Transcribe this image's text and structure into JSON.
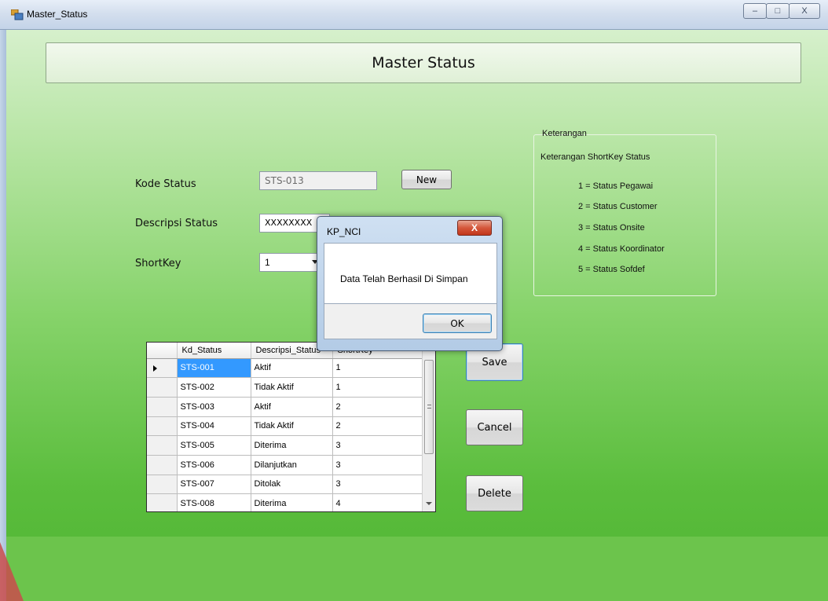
{
  "window": {
    "title": "Master_Status",
    "buttons": {
      "minimize": "–",
      "maximize": "□",
      "close": "X"
    }
  },
  "header": {
    "title": "Master Status"
  },
  "form": {
    "kode_label": "Kode Status",
    "kode_value": "STS-013",
    "new_label": "New",
    "descripsi_label": "Descripsi Status",
    "descripsi_value": "XXXXXXXX",
    "shortkey_label": "ShortKey",
    "shortkey_value": "1"
  },
  "keterangan": {
    "title": "Keterangan",
    "subtitle": "Keterangan ShortKey Status",
    "items": [
      "1 = Status Pegawai",
      "2 = Status Customer",
      "3 = Status Onsite",
      "4 = Status Koordinator",
      "5 = Status Sofdef"
    ]
  },
  "grid": {
    "columns": [
      "Kd_Status",
      "Descripsi_Status",
      "ShortKey"
    ],
    "rows": [
      [
        "STS-001",
        "Aktif",
        "1"
      ],
      [
        "STS-002",
        "Tidak Aktif",
        "1"
      ],
      [
        "STS-003",
        "Aktif",
        "2"
      ],
      [
        "STS-004",
        "Tidak Aktif",
        "2"
      ],
      [
        "STS-005",
        "Diterima",
        "3"
      ],
      [
        "STS-006",
        "Dilanjutkan",
        "3"
      ],
      [
        "STS-007",
        "Ditolak",
        "3"
      ],
      [
        "STS-008",
        "Diterima",
        "4"
      ]
    ]
  },
  "actions": {
    "save": "Save",
    "cancel": "Cancel",
    "delete": "Delete"
  },
  "messagebox": {
    "title": "KP_NCI",
    "close": "X",
    "text": "Data Telah Berhasil Di Simpan",
    "ok": "OK"
  },
  "colors": {
    "background_green": "#5bbd3d",
    "selection_blue": "#3399ff",
    "close_red": "#d5583c"
  }
}
